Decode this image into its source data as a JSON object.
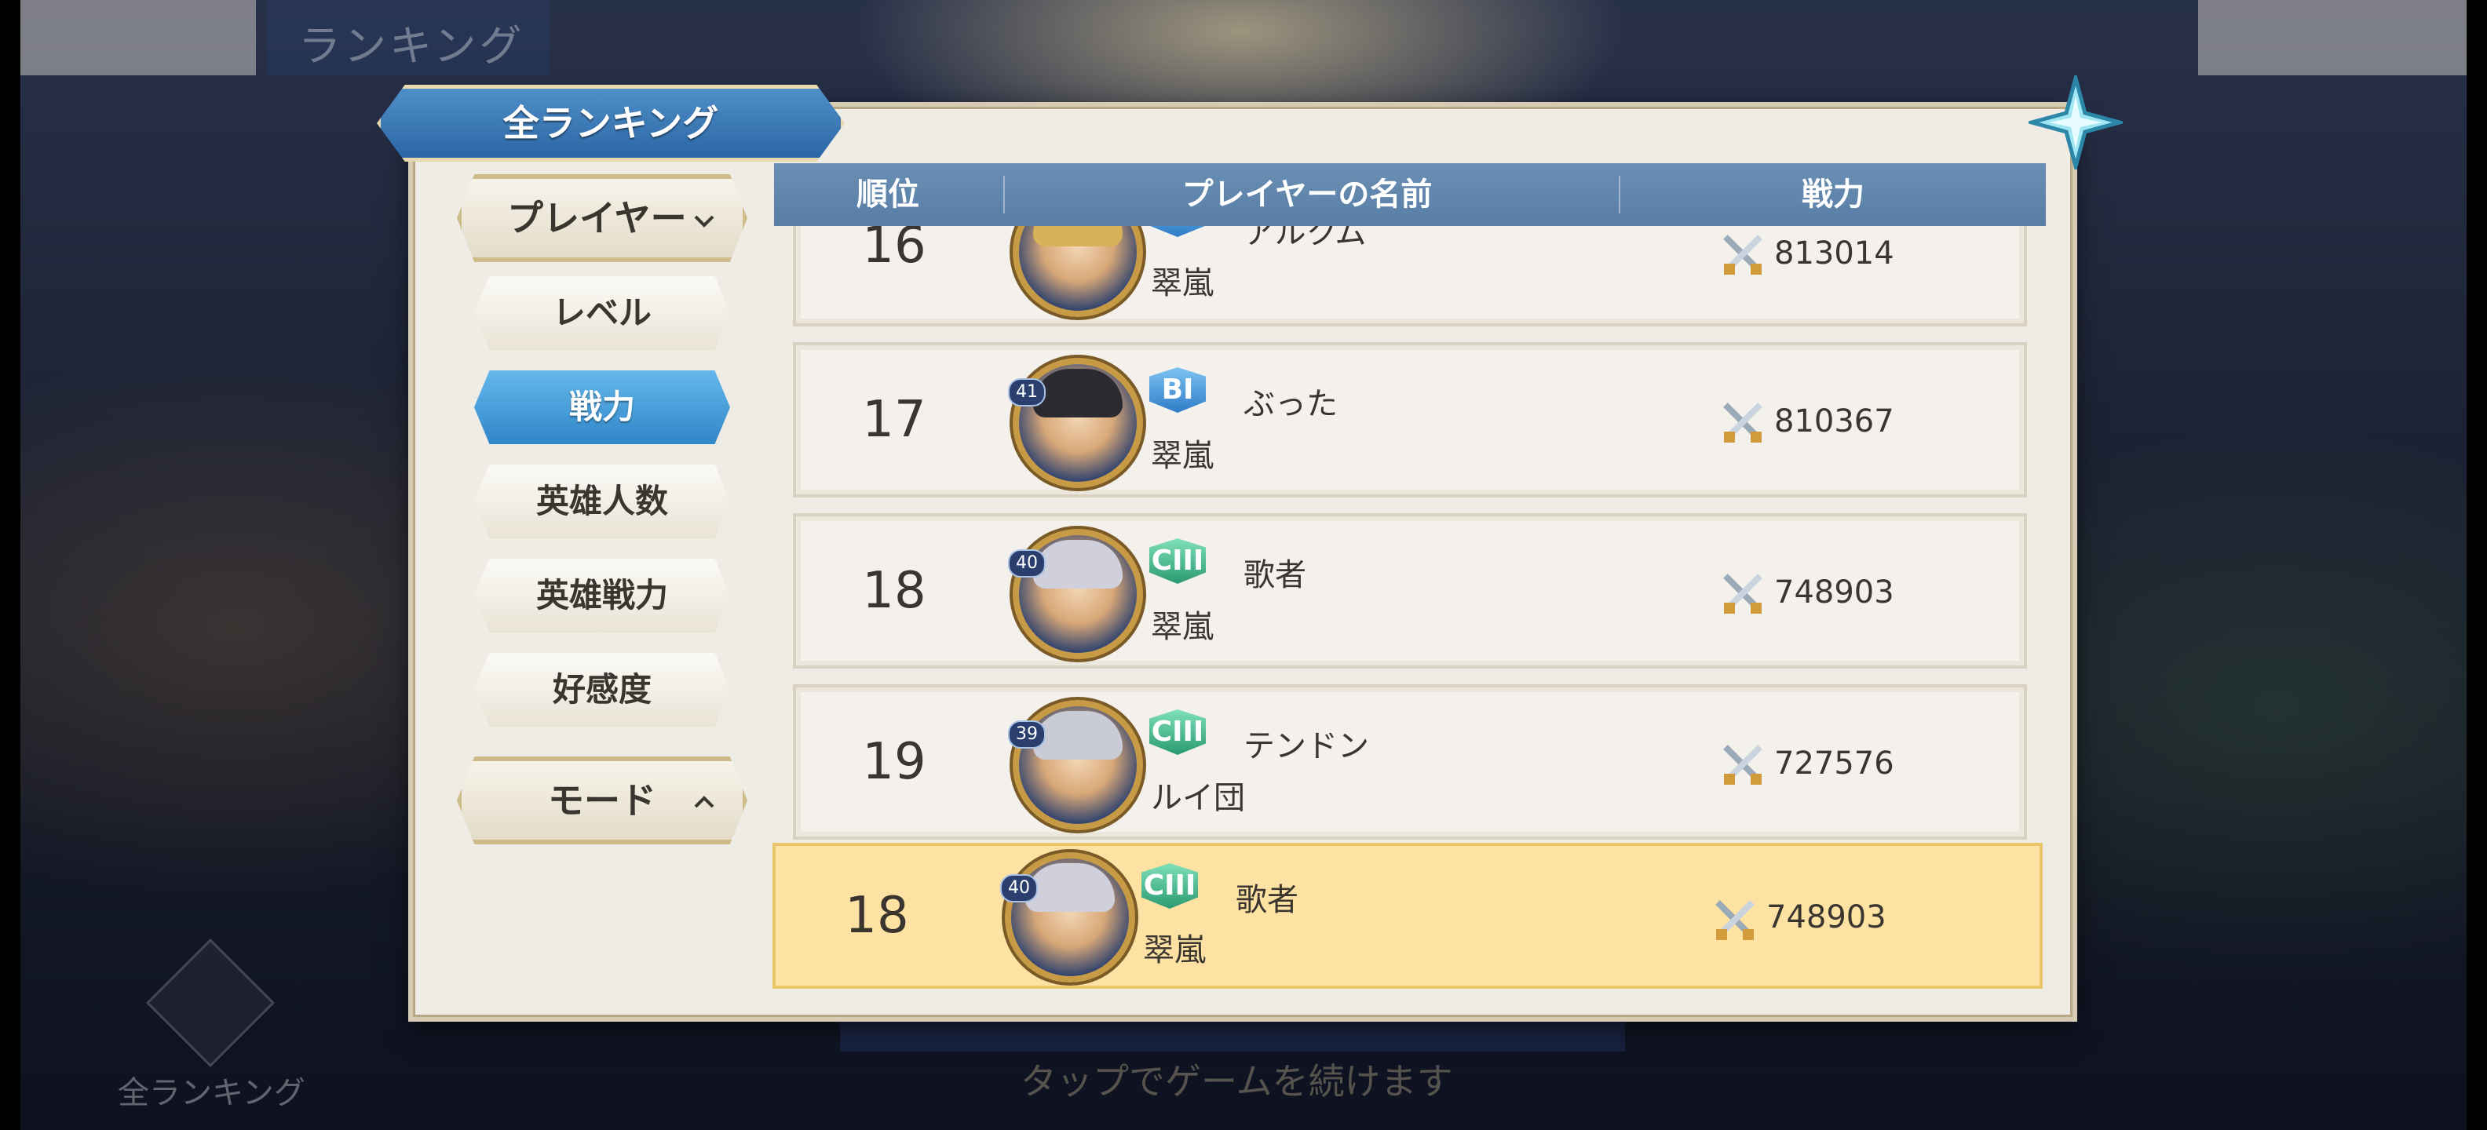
{
  "window": {
    "top_title": "ランキング",
    "footer_hint": "タップでゲームを続けます",
    "bottom_left_label": "全ランキング"
  },
  "panel": {
    "title": "全ランキング"
  },
  "sidebar": {
    "player_dropdown": "プレイヤー",
    "items": [
      {
        "label": "レベル",
        "active": false
      },
      {
        "label": "戦力",
        "active": true
      },
      {
        "label": "英雄人数",
        "active": false
      },
      {
        "label": "英雄戦力",
        "active": false
      },
      {
        "label": "好感度",
        "active": false
      }
    ],
    "mode_dropdown": "モード"
  },
  "table": {
    "headers": [
      "順位",
      "プレイヤーの名前",
      "戦力"
    ],
    "rows": [
      {
        "rank": "16",
        "name": "アルクム",
        "guild": "翠嵐",
        "power": "813014",
        "badge": "B",
        "level": ""
      },
      {
        "rank": "17",
        "name": "ぶった",
        "guild": "翠嵐",
        "power": "810367",
        "badge": "BI",
        "level": "41"
      },
      {
        "rank": "18",
        "name": "歌者",
        "guild": "翠嵐",
        "power": "748903",
        "badge": "CIII",
        "level": "40"
      },
      {
        "rank": "19",
        "name": "テンドン",
        "guild": "ルイ団",
        "power": "727576",
        "badge": "CIII",
        "level": "39"
      }
    ],
    "self_row": {
      "rank": "18",
      "name": "歌者",
      "guild": "翠嵐",
      "power": "748903",
      "badge": "CIII",
      "level": "40"
    }
  },
  "colors": {
    "header_blue": "#6a8fb4",
    "active_tab_blue": "#3b95d6",
    "self_row_yellow": "#fde2a4",
    "badge_green": "#2a9a72",
    "badge_blue": "#2f7cc7"
  },
  "icons": {
    "power": "crossed-swords-icon",
    "close": "star-close-icon",
    "dropdown": "chevron-icon"
  }
}
